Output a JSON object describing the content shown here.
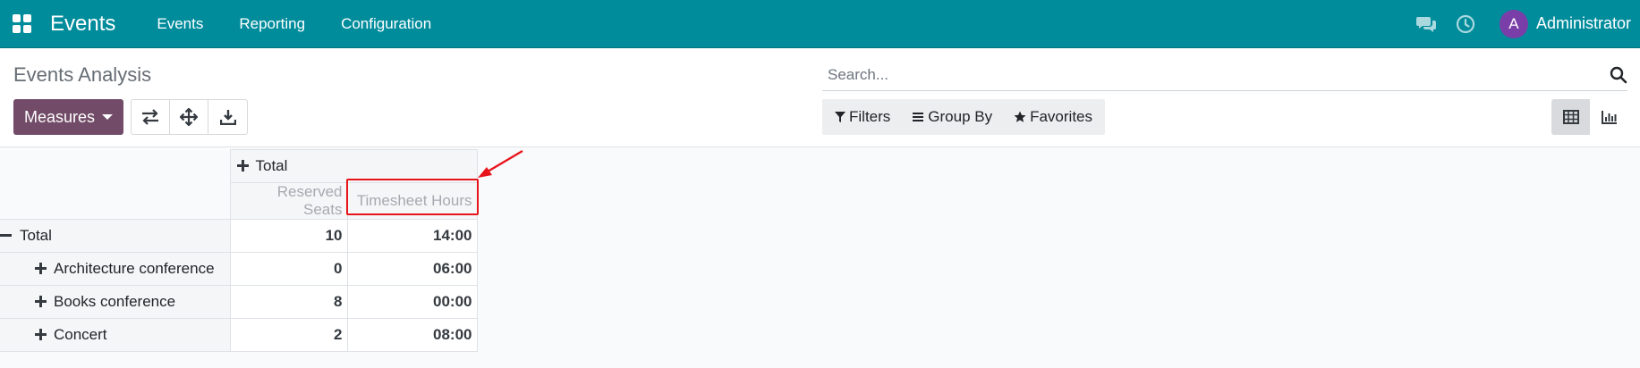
{
  "navbar": {
    "brand": "Events",
    "menu": [
      "Events",
      "Reporting",
      "Configuration"
    ],
    "user_initial": "A",
    "user_name": "Administrator"
  },
  "control_panel": {
    "title": "Events Analysis",
    "measures_label": "Measures",
    "search_placeholder": "Search...",
    "filters_label": "Filters",
    "group_by_label": "Group By",
    "favorites_label": "Favorites"
  },
  "pivot": {
    "column_header": "Total",
    "measures": [
      "Reserved Seats",
      "Timesheet Hours"
    ],
    "total_label": "Total",
    "total_values": [
      "10",
      "14:00"
    ],
    "rows": [
      {
        "label": "Architecture conference",
        "values": [
          "0",
          "06:00"
        ]
      },
      {
        "label": "Books conference",
        "values": [
          "8",
          "00:00"
        ]
      },
      {
        "label": "Concert",
        "values": [
          "2",
          "08:00"
        ]
      }
    ]
  },
  "colors": {
    "navbar": "#018c9c",
    "primary": "#714b67",
    "avatar": "#7a3ea8",
    "annotation": "#e8141b"
  },
  "icons": {
    "apps": "apps-icon",
    "chat": "chat-icon",
    "clock": "clock-icon",
    "flip_axis": "flip-axis-icon",
    "expand_all": "expand-all-icon",
    "download": "download-icon",
    "search": "search-icon",
    "filter": "filter-icon",
    "group_by": "group-by-icon",
    "favorites": "star-icon",
    "pivot_view": "pivot-table-icon",
    "graph_view": "bar-chart-icon"
  }
}
